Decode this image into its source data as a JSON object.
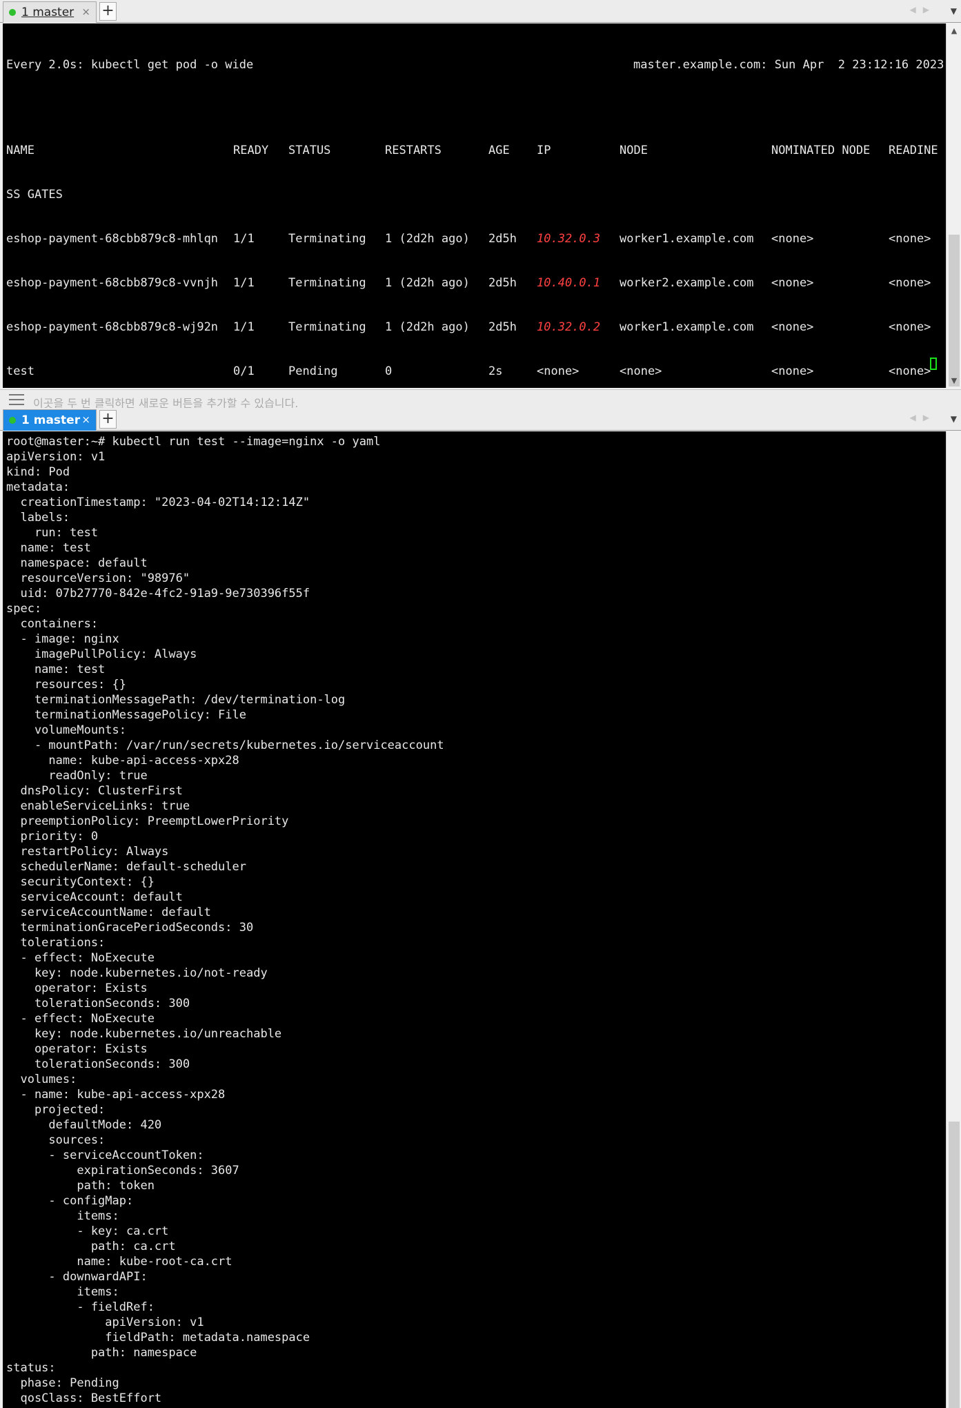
{
  "top_tabbar": {
    "tab_label": "1 master",
    "close": "×",
    "new_tab": "+"
  },
  "watch": {
    "command_line": "Every 2.0s: kubectl get pod -o wide",
    "host_time": "master.example.com: Sun Apr  2 23:12:16 2023",
    "headers": {
      "name": "NAME",
      "ready": "READY",
      "status": "STATUS",
      "restarts": "RESTARTS",
      "age": "AGE",
      "ip": "IP",
      "node": "NODE",
      "nominated": "NOMINATED NODE",
      "readiness": "READINE"
    },
    "header_wrap": "SS GATES",
    "rows": [
      {
        "name": "eshop-payment-68cbb879c8-mhlqn",
        "ready": "1/1",
        "status": "Terminating",
        "restarts": "1 (2d2h ago)",
        "age": "2d5h",
        "ip": "10.32.0.3",
        "node": "worker1.example.com",
        "nominated": "<none>",
        "readiness": "<none>"
      },
      {
        "name": "eshop-payment-68cbb879c8-vvnjh",
        "ready": "1/1",
        "status": "Terminating",
        "restarts": "1 (2d2h ago)",
        "age": "2d5h",
        "ip": "10.40.0.1",
        "node": "worker2.example.com",
        "nominated": "<none>",
        "readiness": "<none>"
      },
      {
        "name": "eshop-payment-68cbb879c8-wj92n",
        "ready": "1/1",
        "status": "Terminating",
        "restarts": "1 (2d2h ago)",
        "age": "2d5h",
        "ip": "10.32.0.2",
        "node": "worker1.example.com",
        "nominated": "<none>",
        "readiness": "<none>"
      },
      {
        "name": "test",
        "ready": "0/1",
        "status": "Pending",
        "restarts": "0",
        "age": "2s",
        "ip": "<none>",
        "node": "<none>",
        "nominated": "<none>",
        "readiness": "<none>"
      }
    ]
  },
  "toolbar": {
    "hint": "이곳을 두 번 클릭하면 새로운 버튼을 추가할 수 있습니다."
  },
  "bottom_tabbar": {
    "tab_label": "1 master",
    "close": "×",
    "new_tab": "+"
  },
  "shell": {
    "lines": [
      "root@master:~# kubectl run test --image=nginx -o yaml",
      "apiVersion: v1",
      "kind: Pod",
      "metadata:",
      "  creationTimestamp: \"2023-04-02T14:12:14Z\"",
      "  labels:",
      "    run: test",
      "  name: test",
      "  namespace: default",
      "  resourceVersion: \"98976\"",
      "  uid: 07b27770-842e-4fc2-91a9-9e730396f55f",
      "spec:",
      "  containers:",
      "  - image: nginx",
      "    imagePullPolicy: Always",
      "    name: test",
      "    resources: {}",
      "    terminationMessagePath: /dev/termination-log",
      "    terminationMessagePolicy: File",
      "    volumeMounts:",
      "    - mountPath: /var/run/secrets/kubernetes.io/serviceaccount",
      "      name: kube-api-access-xpx28",
      "      readOnly: true",
      "  dnsPolicy: ClusterFirst",
      "  enableServiceLinks: true",
      "  preemptionPolicy: PreemptLowerPriority",
      "  priority: 0",
      "  restartPolicy: Always",
      "  schedulerName: default-scheduler",
      "  securityContext: {}",
      "  serviceAccount: default",
      "  serviceAccountName: default",
      "  terminationGracePeriodSeconds: 30",
      "  tolerations:",
      "  - effect: NoExecute",
      "    key: node.kubernetes.io/not-ready",
      "    operator: Exists",
      "    tolerationSeconds: 300",
      "  - effect: NoExecute",
      "    key: node.kubernetes.io/unreachable",
      "    operator: Exists",
      "    tolerationSeconds: 300",
      "  volumes:",
      "  - name: kube-api-access-xpx28",
      "    projected:",
      "      defaultMode: 420",
      "      sources:",
      "      - serviceAccountToken:",
      "          expirationSeconds: 3607",
      "          path: token",
      "      - configMap:",
      "          items:",
      "          - key: ca.crt",
      "            path: ca.crt",
      "          name: kube-root-ca.crt",
      "      - downwardAPI:",
      "          items:",
      "          - fieldRef:",
      "              apiVersion: v1",
      "              fieldPath: metadata.namespace",
      "            path: namespace",
      "status:",
      "  phase: Pending",
      "  qosClass: BestEffort"
    ]
  },
  "colors": {
    "terminal_bg": "#000000",
    "terminal_fg": "#e8e8e8",
    "ip_red": "#ff4040",
    "active_tab": "#1e88e5",
    "cursor_green": "#19e019"
  }
}
